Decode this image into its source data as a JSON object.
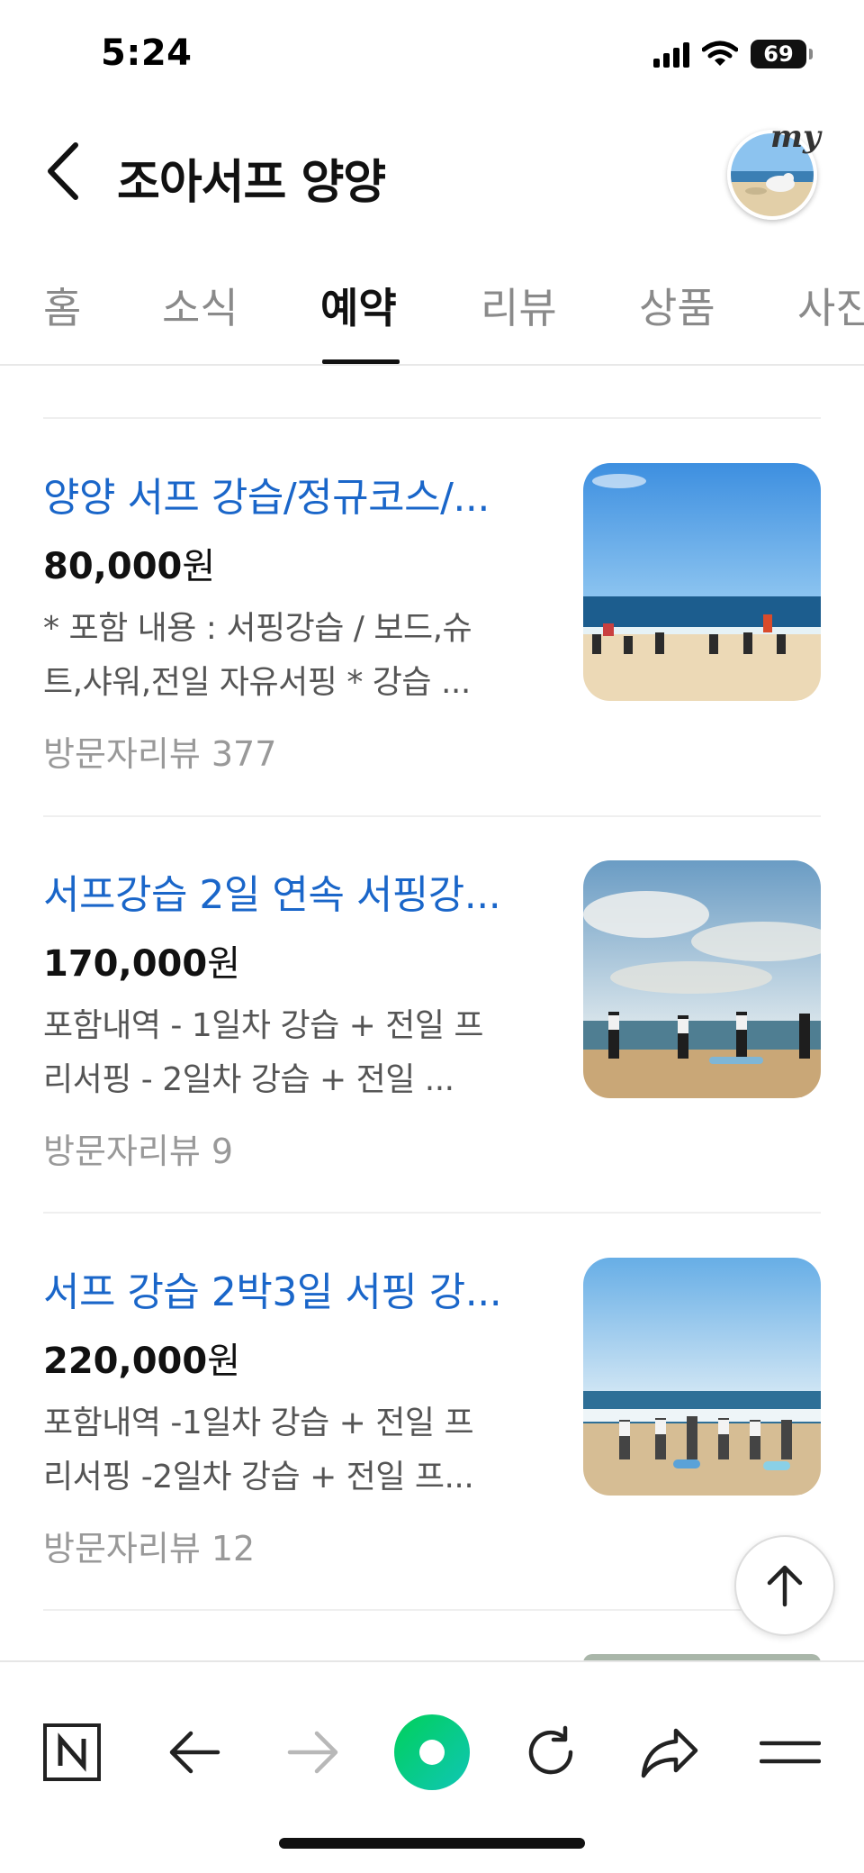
{
  "status_bar": {
    "time": "5:24",
    "battery": "69"
  },
  "header": {
    "title": "조아서프 양양",
    "my_badge": "my"
  },
  "tabs": [
    {
      "label": "홈",
      "active": false
    },
    {
      "label": "소식",
      "active": false
    },
    {
      "label": "예약",
      "active": true
    },
    {
      "label": "리뷰",
      "active": false
    },
    {
      "label": "상품",
      "active": false
    },
    {
      "label": "사진",
      "active": false
    }
  ],
  "products": [
    {
      "title": "양양 서프 강습/정규코스/...",
      "price_number": "80,000",
      "price_unit": "원",
      "desc_line1": "* 포함 내용 : 서핑강습 / 보드,슈",
      "desc_line2": "트,샤워,전일 자유서핑 * 강습 ...",
      "review": "방문자리뷰 377"
    },
    {
      "title": "서프강습 2일 연속 서핑강...",
      "price_number": "170,000",
      "price_unit": "원",
      "desc_line1": "포함내역 - 1일차 강습 + 전일 프",
      "desc_line2": "리서핑 - 2일차 강습 + 전일 ...",
      "review": "방문자리뷰 9"
    },
    {
      "title": "서프 강습 2박3일 서핑 강...",
      "price_number": "220,000",
      "price_unit": "원",
      "desc_line1": "포함내역 -1일차 강습 + 전일 프",
      "desc_line2": "리서핑 -2일차 강습 + 전일 프...",
      "review": "방문자리뷰 12"
    }
  ],
  "icons": {
    "back": "chevron-left-icon",
    "scroll_top": "arrow-up-icon",
    "toolbar": [
      "naver-home-icon",
      "back-arrow-icon",
      "forward-arrow-icon",
      "green-dot-icon",
      "refresh-icon",
      "share-icon",
      "menu-icon"
    ]
  },
  "colors": {
    "link_blue": "#1a66c9",
    "naver_green": "#03c75a"
  }
}
